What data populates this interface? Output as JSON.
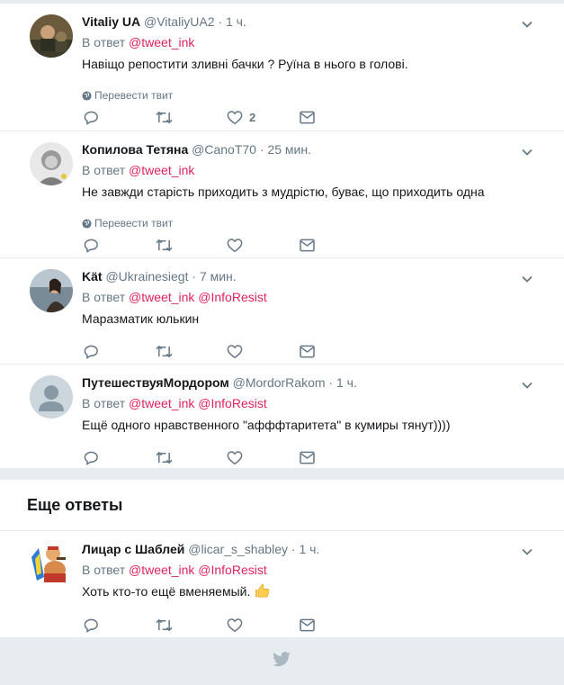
{
  "colors": {
    "accent": "#e0245e",
    "muted": "#657786",
    "background": "#e6ecf0"
  },
  "thread": [
    {
      "name": "Vitaliy UA",
      "handle": "@VitaliyUA2",
      "time": "1 ч.",
      "reply_prefix": "В ответ",
      "mentions": [
        "@tweet_ink"
      ],
      "text": "Навіщо репостити зливні бачки ? Руїна в нього в голові.",
      "translate": "Перевести твит",
      "likes": "2",
      "avatar_icon": "avatar-photo"
    },
    {
      "name": "Копилова Тетяна",
      "handle": "@CanoT70",
      "time": "25 мин.",
      "reply_prefix": "В ответ",
      "mentions": [
        "@tweet_ink"
      ],
      "text": "Не завжди старість приходить з мудрістю, буває, що приходить одна",
      "translate": "Перевести твит",
      "likes": "",
      "avatar_icon": "avatar-photo"
    },
    {
      "name": "Kät",
      "handle": "@Ukrainesiegt",
      "time": "7 мин.",
      "reply_prefix": "В ответ",
      "mentions": [
        "@tweet_ink",
        "@InfoResist"
      ],
      "text": "Маразматик юлькин",
      "translate": "",
      "likes": "",
      "avatar_icon": "avatar-photo"
    },
    {
      "name": "ПутешествуяМордором",
      "handle": "@MordorRakom",
      "time": "1 ч.",
      "reply_prefix": "В ответ",
      "mentions": [
        "@tweet_ink",
        "@InfoResist"
      ],
      "text": "Ещё одного нравственного \"афффтаритета\" в кумиры тянут))))",
      "translate": "",
      "likes": "",
      "avatar_icon": "default-avatar"
    }
  ],
  "more_heading": "Еще ответы",
  "more": [
    {
      "name": "Лицар с Шаблей",
      "handle": "@licar_s_shabley",
      "time": "1 ч.",
      "reply_prefix": "В ответ",
      "mentions": [
        "@tweet_ink",
        "@InfoResist"
      ],
      "text": "Хоть кто-то ещё вменяемый.",
      "emoji": "thumbs-up-icon",
      "likes": "",
      "avatar_icon": "avatar-cossack"
    }
  ]
}
